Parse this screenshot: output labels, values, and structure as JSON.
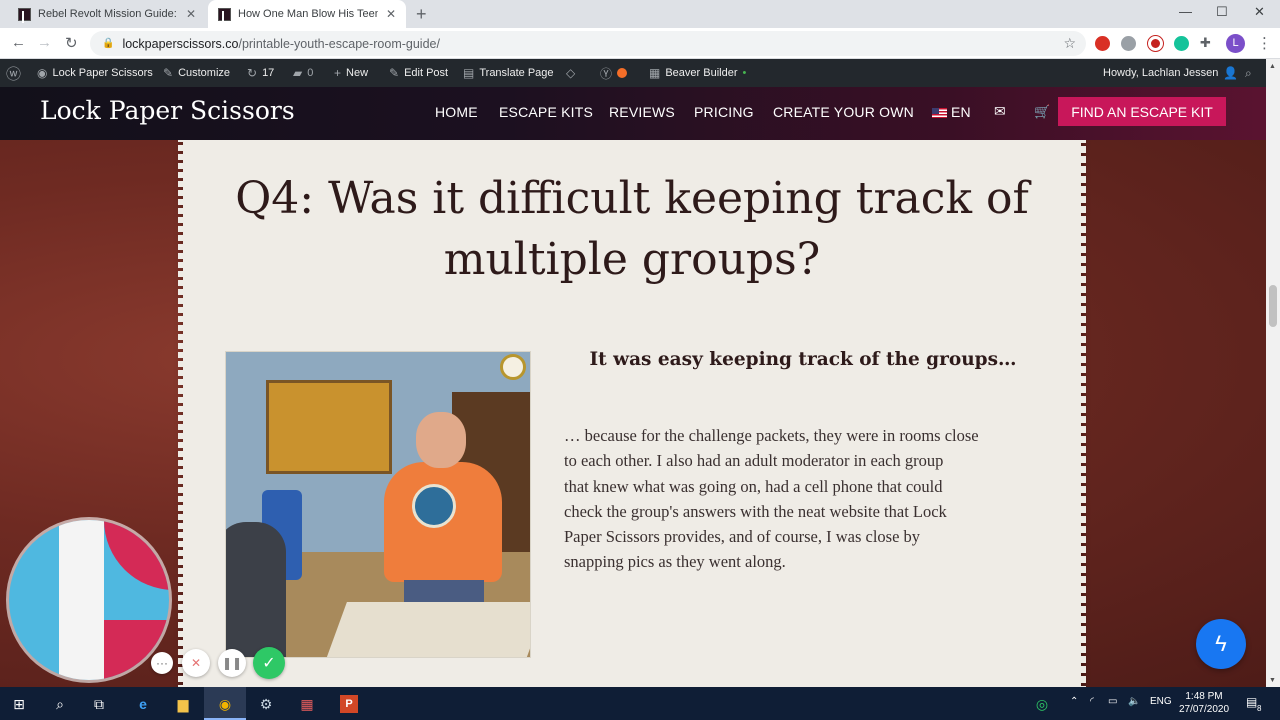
{
  "browser": {
    "tabs": [
      {
        "title": "Rebel Revolt Mission Guide: Chal",
        "active": false
      },
      {
        "title": "How One Man Blow His Teen Yo",
        "active": true
      }
    ],
    "url_domain": "lockpaperscissors.co",
    "url_path": "/printable-youth-escape-room-guide/",
    "profile_initial": "L"
  },
  "adminbar": {
    "site_name": "Lock Paper Scissors",
    "customize": "Customize",
    "updates_count": "17",
    "comments_count": "0",
    "new": "New",
    "edit_post": "Edit Post",
    "translate_page": "Translate Page",
    "beaver_builder": "Beaver Builder",
    "howdy": "Howdy, Lachlan Jessen"
  },
  "header": {
    "logo": "Lock Paper Scissors",
    "menu": [
      "HOME",
      "ESCAPE KITS",
      "REVIEWS",
      "PRICING",
      "CREATE YOUR OWN"
    ],
    "language": "EN",
    "cta": "FIND AN ESCAPE KIT"
  },
  "content": {
    "heading_line1": "Q4: Was it difficult keeping track of",
    "heading_line2": "multiple groups?",
    "subheading": "It was easy keeping track of the groups…",
    "body_lines": [
      "… because for the challenge packets, they were in rooms close",
      "to each other.  I also had an adult moderator in each group",
      "that knew what was going on, had a cell phone that could",
      "check the group's answers with the neat website that Lock",
      "Paper Scissors provides, and of course, I was close by",
      "snapping pics as they went along."
    ]
  },
  "taskbar": {
    "language": "ENG",
    "time": "1:48 PM",
    "date": "27/07/2020",
    "notifications": "8"
  },
  "colors": {
    "cta": "#c8175a",
    "paper": "#efece6",
    "heading_text": "#2e1a1a",
    "messenger": "#1877f2",
    "recorder_green": "#2ec866"
  }
}
